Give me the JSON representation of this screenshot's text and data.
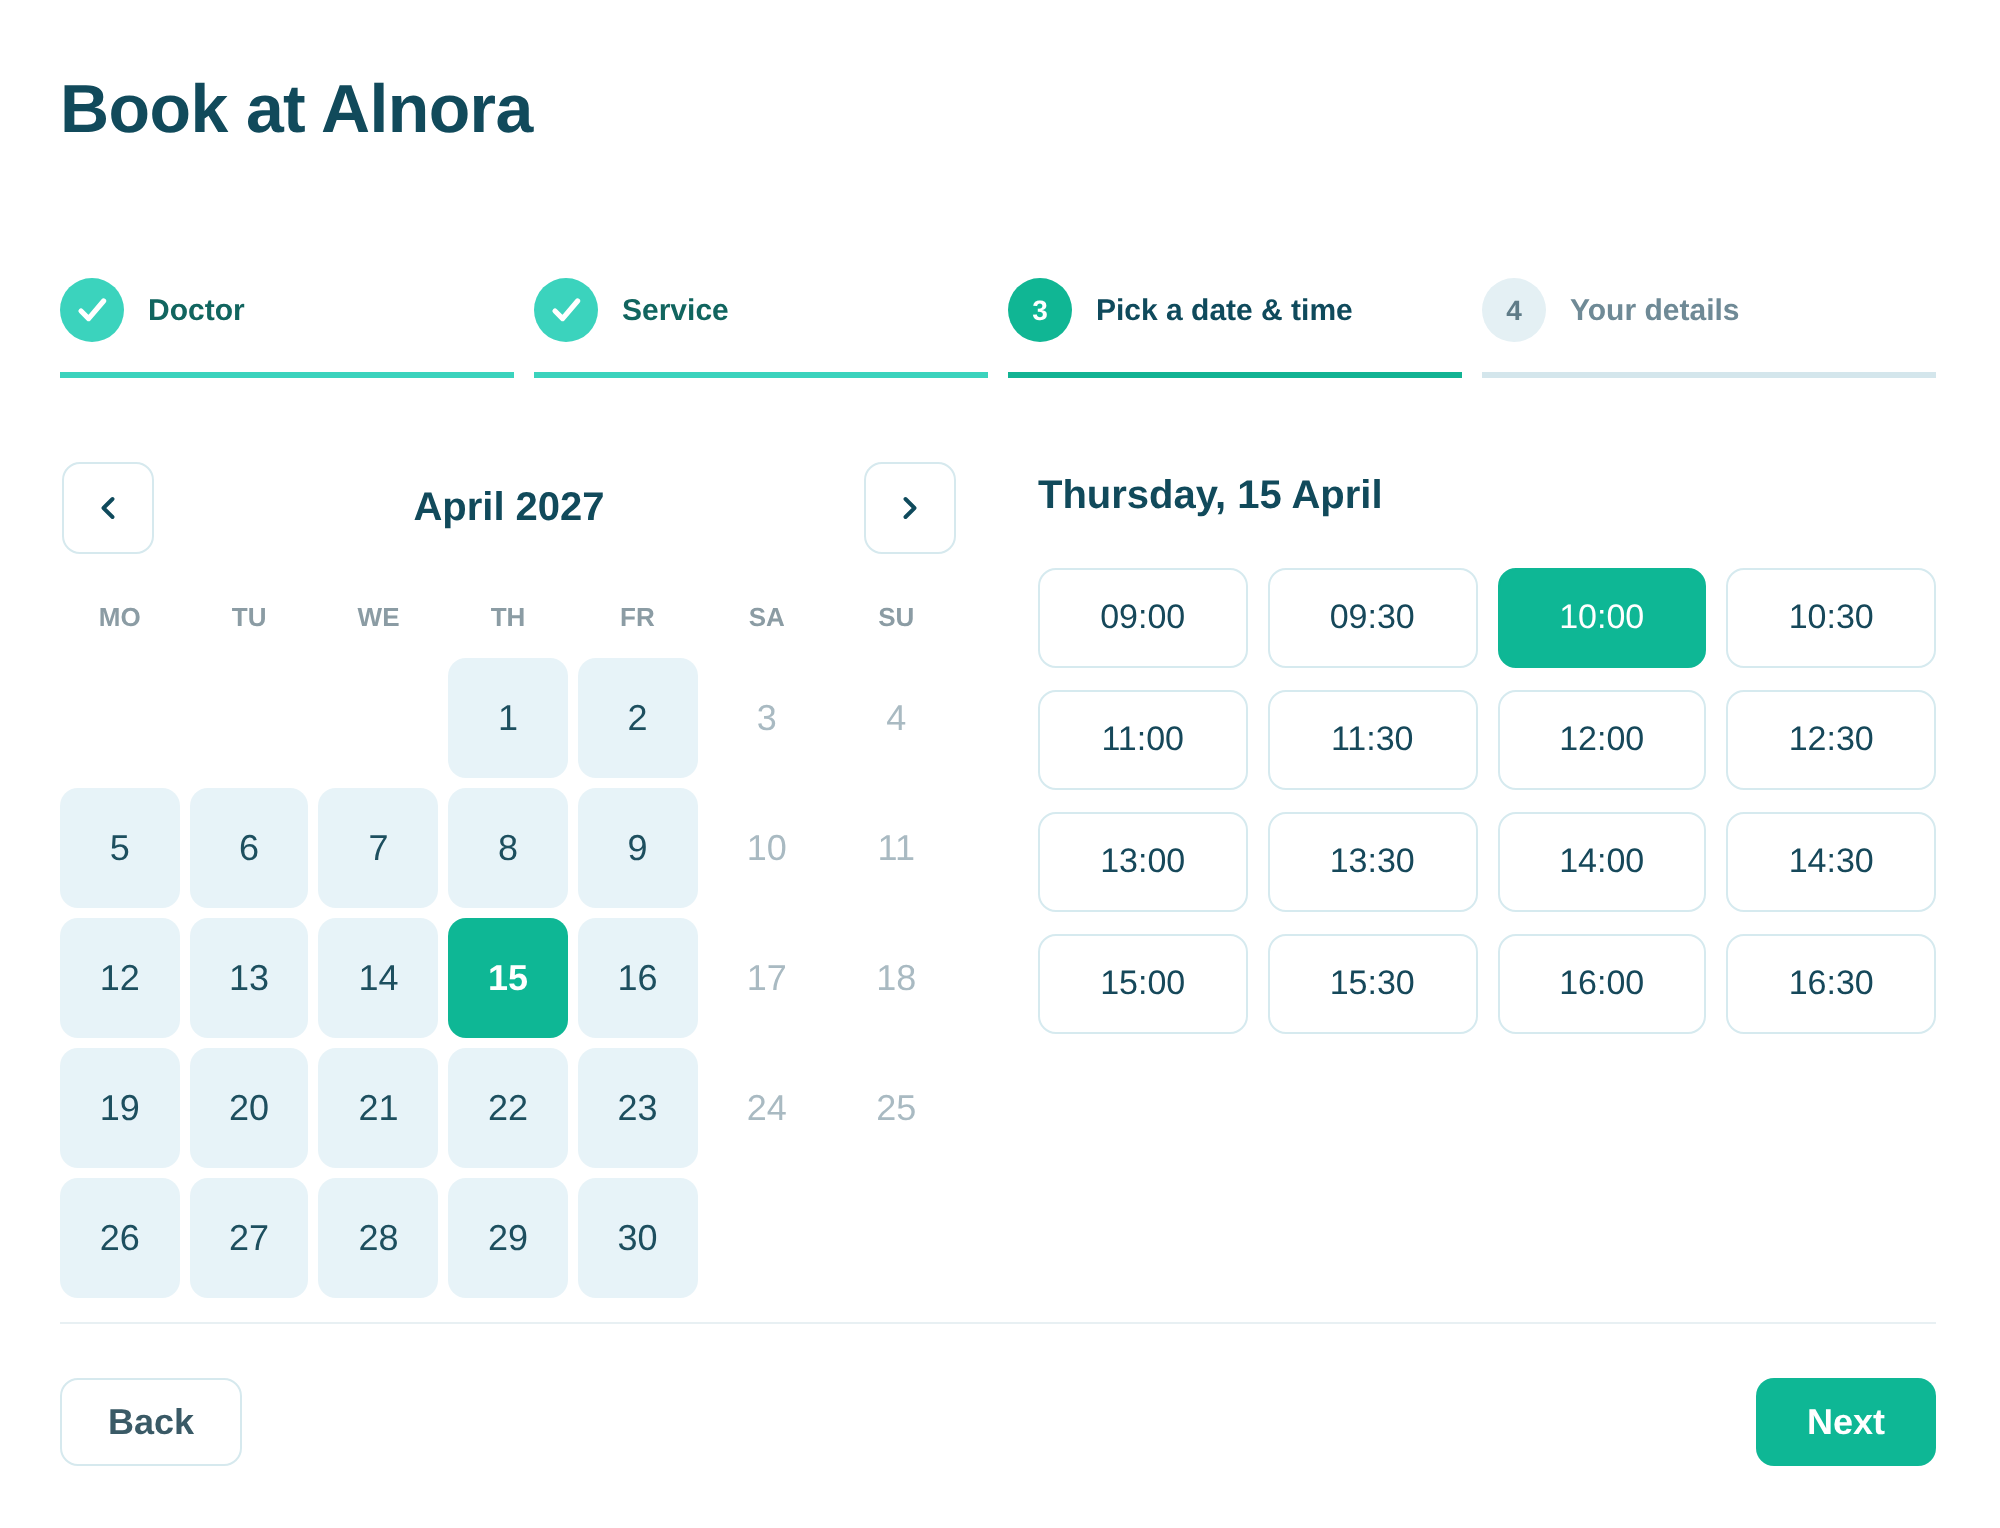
{
  "title": "Book at Alnora",
  "steps": [
    {
      "label": "Doctor",
      "done": true,
      "selected": false
    },
    {
      "label": "Service",
      "done": true,
      "selected": false
    },
    {
      "label": "Pick a date & time",
      "number": "3",
      "done": false,
      "selected": true
    },
    {
      "label": "Your details",
      "number": "4",
      "done": false,
      "selected": false
    }
  ],
  "calendar": {
    "month": "April 2027",
    "weekdays": [
      "MO",
      "TU",
      "WE",
      "TH",
      "FR",
      "SA",
      "SU"
    ],
    "weeks": [
      {
        "days": [
          {
            "label": "1",
            "disabled": false,
            "selected": false
          },
          {
            "label": "2",
            "disabled": false,
            "selected": false
          },
          {
            "label": "3",
            "disabled": true,
            "selected": false
          },
          {
            "label": "4",
            "disabled": true,
            "selected": false
          }
        ]
      },
      {
        "days": [
          {
            "label": "5",
            "disabled": false,
            "selected": false
          },
          {
            "label": "6",
            "disabled": false,
            "selected": false
          },
          {
            "label": "7",
            "disabled": false,
            "selected": false
          },
          {
            "label": "8",
            "disabled": false,
            "selected": false
          },
          {
            "label": "9",
            "disabled": false,
            "selected": false
          },
          {
            "label": "10",
            "disabled": true,
            "selected": false
          },
          {
            "label": "11",
            "disabled": true,
            "selected": false
          }
        ]
      },
      {
        "days": [
          {
            "label": "12",
            "disabled": false,
            "selected": false
          },
          {
            "label": "13",
            "disabled": false,
            "selected": false
          },
          {
            "label": "14",
            "disabled": false,
            "selected": false
          },
          {
            "label": "15",
            "disabled": false,
            "selected": true
          },
          {
            "label": "16",
            "disabled": false,
            "selected": false
          },
          {
            "label": "17",
            "disabled": true,
            "selected": false
          },
          {
            "label": "18",
            "disabled": true,
            "selected": false
          }
        ]
      },
      {
        "days": [
          {
            "label": "19",
            "disabled": false,
            "selected": false
          },
          {
            "label": "20",
            "disabled": false,
            "selected": false
          },
          {
            "label": "21",
            "disabled": false,
            "selected": false
          },
          {
            "label": "22",
            "disabled": false,
            "selected": false
          },
          {
            "label": "23",
            "disabled": false,
            "selected": false
          },
          {
            "label": "24",
            "disabled": true,
            "selected": false
          },
          {
            "label": "25",
            "disabled": true,
            "selected": false
          }
        ]
      },
      {
        "days": [
          {
            "label": "26",
            "disabled": false,
            "selected": false
          },
          {
            "label": "27",
            "disabled": false,
            "selected": false
          },
          {
            "label": "28",
            "disabled": false,
            "selected": false
          },
          {
            "label": "29",
            "disabled": false,
            "selected": false
          },
          {
            "label": "30",
            "disabled": false,
            "selected": false
          }
        ]
      }
    ]
  },
  "times": {
    "heading": "Thursday, 15 April",
    "slots": [
      {
        "label": "09:00",
        "selected": false
      },
      {
        "label": "09:30",
        "selected": false
      },
      {
        "label": "10:00",
        "selected": true
      },
      {
        "label": "10:30",
        "selected": false
      },
      {
        "label": "11:00",
        "selected": false
      },
      {
        "label": "11:30",
        "selected": false
      },
      {
        "label": "12:00",
        "selected": false
      },
      {
        "label": "12:30",
        "selected": false
      },
      {
        "label": "13:00",
        "selected": false
      },
      {
        "label": "13:30",
        "selected": false
      },
      {
        "label": "14:00",
        "selected": false
      },
      {
        "label": "14:30",
        "selected": false
      },
      {
        "label": "15:00",
        "selected": false
      },
      {
        "label": "15:30",
        "selected": false
      },
      {
        "label": "16:00",
        "selected": false
      },
      {
        "label": "16:30",
        "selected": false
      }
    ]
  },
  "footer": {
    "back": "Back",
    "next": "Next"
  }
}
